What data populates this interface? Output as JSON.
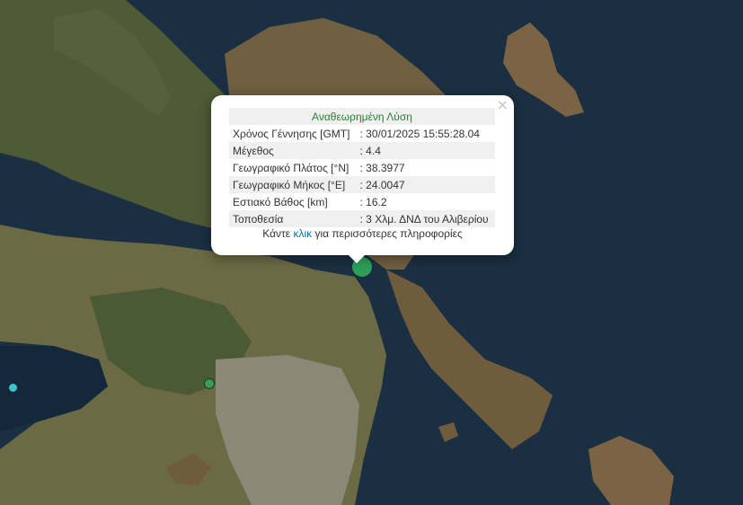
{
  "popup": {
    "title": "Αναθεωρημένη Λύση",
    "close_label": "×",
    "rows": [
      {
        "label": "Χρόνος Γέννησης [GMT]",
        "value": ": 30/01/2025 15:55:28.04"
      },
      {
        "label": "Μέγεθος",
        "value": ": 4.4"
      },
      {
        "label": "Γεωγραφικό Πλάτος [°N]",
        "value": ": 38.3977"
      },
      {
        "label": "Γεωγραφικό Μήκος [°E]",
        "value": ": 24.0047"
      },
      {
        "label": "Εστιακό Βάθος [km]",
        "value": ": 16.2"
      },
      {
        "label": "Τοποθεσία",
        "value": ": 3 Χλμ. ΔΝΔ του Αλιβερίου"
      }
    ],
    "more_prefix": "Κάντε ",
    "more_link": "κλικ",
    "more_suffix": " για περισσότερες πληροφορίες"
  },
  "markers": {
    "selected_color": "#2e9e58",
    "green_color": "#3c9a5a",
    "cyan_color": "#3cc3d3"
  },
  "colors": {
    "sea": "#1b2f42",
    "land": "#6b6a44"
  }
}
